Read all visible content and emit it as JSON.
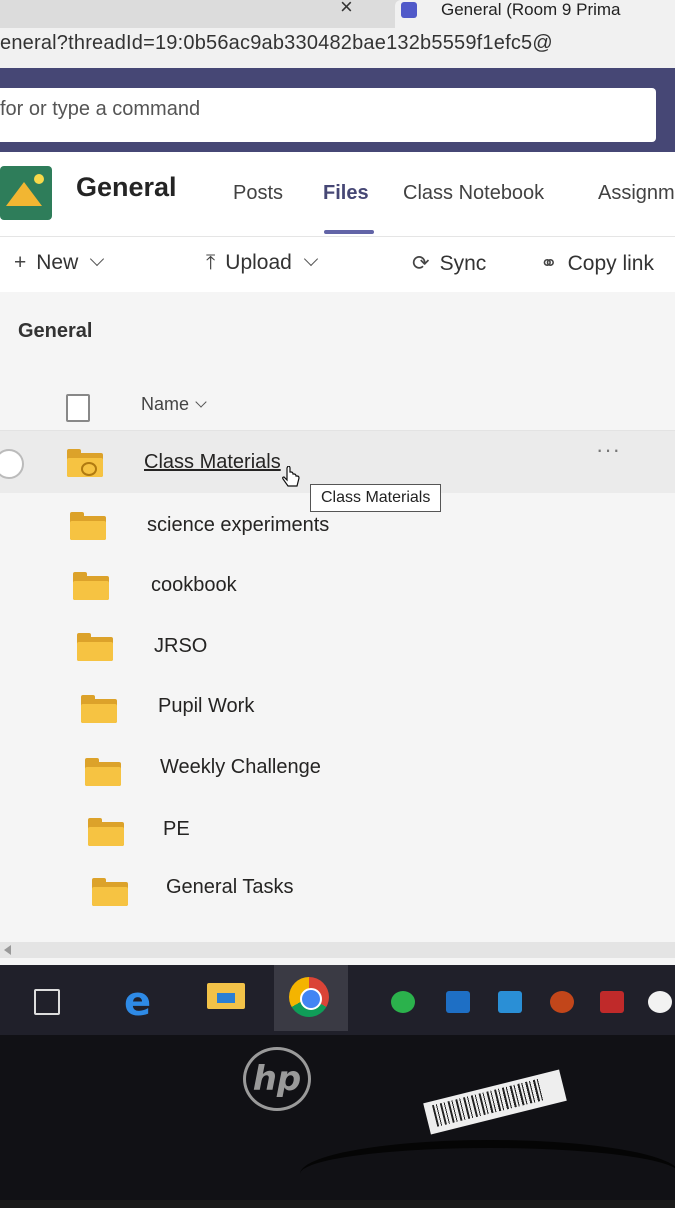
{
  "browser": {
    "tab_title": "General (Room 9 Prima",
    "url": "eneral?threadId=19:0b56ac9ab330482bae132b5559f1efc5@"
  },
  "search": {
    "placeholder": "for or type a command"
  },
  "channel": {
    "title": "General",
    "tabs": [
      "Posts",
      "Files",
      "Class Notebook",
      "Assignm"
    ],
    "active_tab": "Files"
  },
  "toolbar": {
    "new_label": "New",
    "upload_label": "Upload",
    "sync_label": "Sync",
    "copy_link_label": "Copy link"
  },
  "folder_view": {
    "title": "General",
    "name_column": "Name",
    "items": [
      "Class Materials",
      "science experiments",
      "cookbook",
      "JRSO",
      "Pupil Work",
      "Weekly Challenge",
      "PE",
      "General Tasks"
    ],
    "more_label": "···",
    "tooltip": "Class Materials"
  },
  "icons": {
    "new": "plus-icon",
    "upload": "upload-icon",
    "sync": "sync-icon",
    "copy_link": "link-icon",
    "folder": "folder-icon",
    "file": "file-icon"
  },
  "monitor": {
    "brand": "hp"
  },
  "colors": {
    "teams_purple": "#6264a7",
    "header_bar": "#464775",
    "folder_yellow": "#f6c342"
  }
}
